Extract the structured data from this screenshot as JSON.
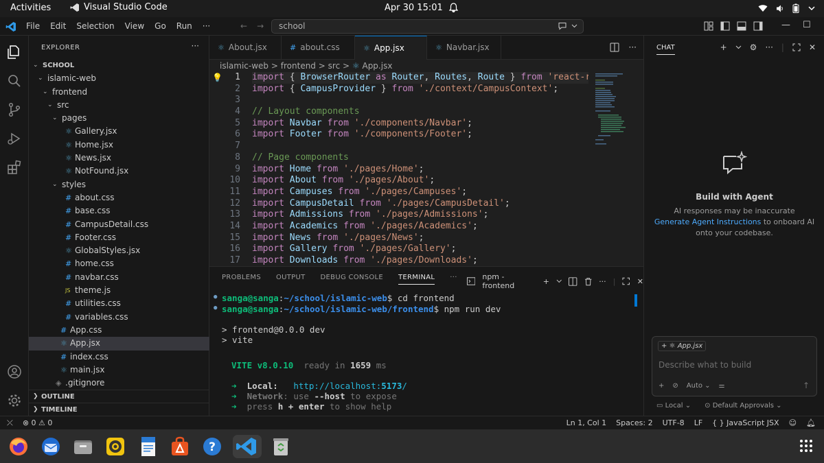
{
  "system": {
    "activities": "Activities",
    "app_name": "Visual Studio Code",
    "clock": "Apr 30  15:01"
  },
  "titlebar": {
    "menu": [
      "File",
      "Edit",
      "Selection",
      "View",
      "Go",
      "Run",
      "···"
    ],
    "command_center": "school"
  },
  "explorer": {
    "header": "EXPLORER",
    "more": "···",
    "tree": [
      {
        "label": "SCHOOL",
        "depth": 0,
        "type": "root"
      },
      {
        "label": "islamic-web",
        "depth": 1,
        "type": "folder"
      },
      {
        "label": "frontend",
        "depth": 2,
        "type": "folder"
      },
      {
        "label": "src",
        "depth": 3,
        "type": "folder"
      },
      {
        "label": "pages",
        "depth": 4,
        "type": "folder"
      },
      {
        "label": "Gallery.jsx",
        "depth": 5,
        "type": "react"
      },
      {
        "label": "Home.jsx",
        "depth": 5,
        "type": "react"
      },
      {
        "label": "News.jsx",
        "depth": 5,
        "type": "react"
      },
      {
        "label": "NotFound.jsx",
        "depth": 5,
        "type": "react"
      },
      {
        "label": "styles",
        "depth": 4,
        "type": "folder"
      },
      {
        "label": "about.css",
        "depth": 5,
        "type": "css"
      },
      {
        "label": "base.css",
        "depth": 5,
        "type": "css"
      },
      {
        "label": "CampusDetail.css",
        "depth": 5,
        "type": "css"
      },
      {
        "label": "Footer.css",
        "depth": 5,
        "type": "css"
      },
      {
        "label": "GlobalStyles.jsx",
        "depth": 5,
        "type": "react"
      },
      {
        "label": "home.css",
        "depth": 5,
        "type": "css"
      },
      {
        "label": "navbar.css",
        "depth": 5,
        "type": "css"
      },
      {
        "label": "theme.js",
        "depth": 5,
        "type": "js"
      },
      {
        "label": "utilities.css",
        "depth": 5,
        "type": "css"
      },
      {
        "label": "variables.css",
        "depth": 5,
        "type": "css"
      },
      {
        "label": "App.css",
        "depth": 4,
        "type": "css"
      },
      {
        "label": "App.jsx",
        "depth": 4,
        "type": "react",
        "selected": true
      },
      {
        "label": "index.css",
        "depth": 4,
        "type": "css"
      },
      {
        "label": "main.jsx",
        "depth": 4,
        "type": "react"
      },
      {
        "label": ".gitignore",
        "depth": 3,
        "type": "git"
      }
    ],
    "outline": "OUTLINE",
    "timeline": "TIMELINE"
  },
  "tabs": [
    {
      "label": "About.jsx",
      "icon": "react"
    },
    {
      "label": "about.css",
      "icon": "css"
    },
    {
      "label": "App.jsx",
      "icon": "react",
      "active": true
    },
    {
      "label": "Navbar.jsx",
      "icon": "react"
    }
  ],
  "breadcrumb": {
    "parts": [
      "islamic-web",
      "frontend",
      "src",
      "App.jsx"
    ],
    "sep": ">"
  },
  "editor": {
    "line_numbers": [
      "1",
      "2",
      "3",
      "4",
      "5",
      "6",
      "7",
      "8",
      "9",
      "10",
      "11",
      "12",
      "13",
      "14",
      "15",
      "16",
      "17"
    ],
    "lines": [
      [
        [
          "k",
          "import"
        ],
        [
          "p",
          " { "
        ],
        [
          "v",
          "BrowserRouter"
        ],
        [
          "p",
          " "
        ],
        [
          "k",
          "as"
        ],
        [
          "p",
          " "
        ],
        [
          "v",
          "Router"
        ],
        [
          "p",
          ", "
        ],
        [
          "v",
          "Routes"
        ],
        [
          "p",
          ", "
        ],
        [
          "v",
          "Route"
        ],
        [
          "p",
          " } "
        ],
        [
          "k",
          "from"
        ],
        [
          "p",
          " "
        ],
        [
          "s",
          "'react-router-dom';"
        ]
      ],
      [
        [
          "k",
          "import"
        ],
        [
          "p",
          " { "
        ],
        [
          "v",
          "CampusProvider"
        ],
        [
          "p",
          " } "
        ],
        [
          "k",
          "from"
        ],
        [
          "p",
          " "
        ],
        [
          "s",
          "'./context/CampusContext'"
        ],
        [
          "p",
          ";"
        ]
      ],
      [],
      [
        [
          "c",
          "// Layout components"
        ]
      ],
      [
        [
          "k",
          "import"
        ],
        [
          "p",
          " "
        ],
        [
          "v",
          "Navbar"
        ],
        [
          "p",
          " "
        ],
        [
          "k",
          "from"
        ],
        [
          "p",
          " "
        ],
        [
          "s",
          "'./components/Navbar'"
        ],
        [
          "p",
          ";"
        ]
      ],
      [
        [
          "k",
          "import"
        ],
        [
          "p",
          " "
        ],
        [
          "v",
          "Footer"
        ],
        [
          "p",
          " "
        ],
        [
          "k",
          "from"
        ],
        [
          "p",
          " "
        ],
        [
          "s",
          "'./components/Footer'"
        ],
        [
          "p",
          ";"
        ]
      ],
      [],
      [
        [
          "c",
          "// Page components"
        ]
      ],
      [
        [
          "k",
          "import"
        ],
        [
          "p",
          " "
        ],
        [
          "v",
          "Home"
        ],
        [
          "p",
          " "
        ],
        [
          "k",
          "from"
        ],
        [
          "p",
          " "
        ],
        [
          "s",
          "'./pages/Home'"
        ],
        [
          "p",
          ";"
        ]
      ],
      [
        [
          "k",
          "import"
        ],
        [
          "p",
          " "
        ],
        [
          "v",
          "About"
        ],
        [
          "p",
          " "
        ],
        [
          "k",
          "from"
        ],
        [
          "p",
          " "
        ],
        [
          "s",
          "'./pages/About'"
        ],
        [
          "p",
          ";"
        ]
      ],
      [
        [
          "k",
          "import"
        ],
        [
          "p",
          " "
        ],
        [
          "v",
          "Campuses"
        ],
        [
          "p",
          " "
        ],
        [
          "k",
          "from"
        ],
        [
          "p",
          " "
        ],
        [
          "s",
          "'./pages/Campuses'"
        ],
        [
          "p",
          ";"
        ]
      ],
      [
        [
          "k",
          "import"
        ],
        [
          "p",
          " "
        ],
        [
          "v",
          "CampusDetail"
        ],
        [
          "p",
          " "
        ],
        [
          "k",
          "from"
        ],
        [
          "p",
          " "
        ],
        [
          "s",
          "'./pages/CampusDetail'"
        ],
        [
          "p",
          ";"
        ]
      ],
      [
        [
          "k",
          "import"
        ],
        [
          "p",
          " "
        ],
        [
          "v",
          "Admissions"
        ],
        [
          "p",
          " "
        ],
        [
          "k",
          "from"
        ],
        [
          "p",
          " "
        ],
        [
          "s",
          "'./pages/Admissions'"
        ],
        [
          "p",
          ";"
        ]
      ],
      [
        [
          "k",
          "import"
        ],
        [
          "p",
          " "
        ],
        [
          "v",
          "Academics"
        ],
        [
          "p",
          " "
        ],
        [
          "k",
          "from"
        ],
        [
          "p",
          " "
        ],
        [
          "s",
          "'./pages/Academics'"
        ],
        [
          "p",
          ";"
        ]
      ],
      [
        [
          "k",
          "import"
        ],
        [
          "p",
          " "
        ],
        [
          "v",
          "News"
        ],
        [
          "p",
          " "
        ],
        [
          "k",
          "from"
        ],
        [
          "p",
          " "
        ],
        [
          "s",
          "'./pages/News'"
        ],
        [
          "p",
          ";"
        ]
      ],
      [
        [
          "k",
          "import"
        ],
        [
          "p",
          " "
        ],
        [
          "v",
          "Gallery"
        ],
        [
          "p",
          " "
        ],
        [
          "k",
          "from"
        ],
        [
          "p",
          " "
        ],
        [
          "s",
          "'./pages/Gallery'"
        ],
        [
          "p",
          ";"
        ]
      ],
      [
        [
          "k",
          "import"
        ],
        [
          "p",
          " "
        ],
        [
          "v",
          "Downloads"
        ],
        [
          "p",
          " "
        ],
        [
          "k",
          "from"
        ],
        [
          "p",
          " "
        ],
        [
          "s",
          "'./pages/Downloads'"
        ],
        [
          "p",
          ";"
        ]
      ]
    ]
  },
  "panel": {
    "tabs": [
      "PROBLEMS",
      "OUTPUT",
      "DEBUG CONSOLE",
      "TERMINAL",
      "···"
    ],
    "active_tab": "TERMINAL",
    "terminal_name": "npm - frontend",
    "terminal": {
      "cmd1_user": "sanga@sanga",
      "cmd1_path": "~/school/islamic-web",
      "cmd1_text": "$ cd frontend",
      "cmd2_user": "sanga@sanga",
      "cmd2_path": "~/school/islamic-web/frontend",
      "cmd2_text": "$ npm run dev",
      "out1": "> frontend@0.0.0 dev",
      "out2": "> vite",
      "vite_label": "VITE v8.0.10",
      "ready": "  ready in ",
      "ready_ms": "1659",
      "ready_unit": " ms",
      "local_label": "Local:",
      "local_url_a": "http://localhost:",
      "local_url_b": "5173",
      "local_url_c": "/",
      "network_label": "Network",
      "network_a": ": use ",
      "network_b": "--host",
      "network_c": " to expose",
      "help_a": "press ",
      "help_b": "h + enter",
      "help_c": " to show help",
      "arrow": "➜"
    }
  },
  "chat": {
    "header": "CHAT",
    "title": "Build with Agent",
    "line1": "AI responses may be inaccurate",
    "link": "Generate Agent Instructions",
    "line2_rest": " to onboard AI",
    "line3": "onto your codebase.",
    "context_chip": "App.jsx",
    "placeholder": "Describe what to build",
    "mode": "Auto",
    "footer_left": "Local",
    "footer_right": "Default Approvals"
  },
  "statusbar": {
    "errors": "0",
    "warnings": "0",
    "position": "Ln 1, Col 1",
    "spaces": "Spaces: 2",
    "encoding": "UTF-8",
    "eol": "LF",
    "language": "JavaScript JSX",
    "braces": "{ }"
  },
  "colors": {
    "accent": "#0078d4",
    "keyword": "#c586c0",
    "variable": "#9cdcfe",
    "string": "#ce9178",
    "comment": "#6a9955",
    "terminal_green": "#0dbc79",
    "terminal_blue": "#3b8eea"
  }
}
